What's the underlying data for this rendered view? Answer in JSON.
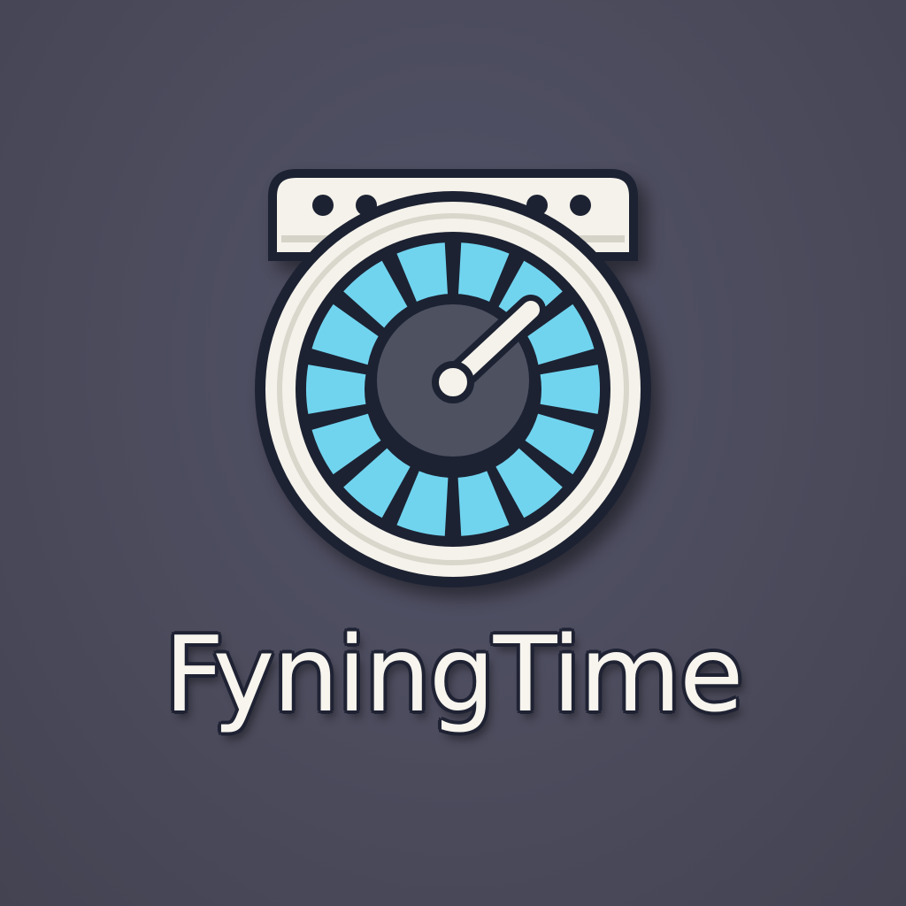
{
  "brand": {
    "name": "FyningTime"
  },
  "logo": {
    "icon": "washing-machine-timer-icon",
    "dial_segments": 14
  },
  "colors": {
    "background": "#4b4b5c",
    "outline": "#1f2233",
    "body": "#f4f2ea",
    "dial_fill": "#6fd4ef",
    "text": "#f7f5ee"
  }
}
